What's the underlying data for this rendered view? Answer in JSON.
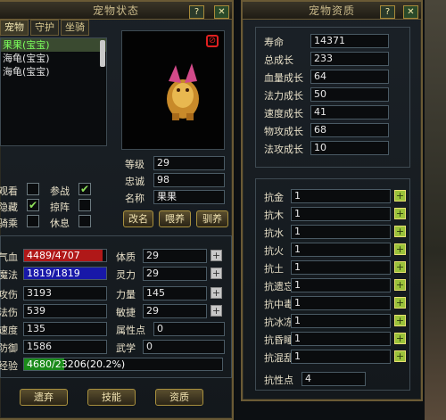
{
  "colors": {
    "hp_bar": "#b01818",
    "mp_bar": "#1818a8",
    "exp_bar": "#1a8a1a",
    "selected_text": "#7cff5c"
  },
  "left_panel": {
    "title": "宠物状态",
    "help_label": "?",
    "close_label": "✕",
    "tabs": [
      "宠物",
      "守护",
      "坐骑"
    ],
    "pets": [
      "果果(宝宝)",
      "海龟(宝宝)",
      "海龟(宝宝)"
    ],
    "options": {
      "watch": "观看",
      "fight": "参战",
      "hide": "隐藏",
      "dodge": "掠阵",
      "ride": "骑乘",
      "rest": "休息"
    },
    "info": {
      "level_label": "等级",
      "level": "29",
      "loyalty_label": "忠诚",
      "loyalty": "98",
      "name_label": "名称",
      "name": "果果"
    },
    "actions": {
      "rename": "改名",
      "feed": "喂养",
      "train": "驯养"
    },
    "stats": {
      "hp_label": "气血",
      "hp": "4489/4707",
      "mp_label": "魔法",
      "mp": "1819/1819",
      "atk_label": "攻伤",
      "atk": "3193",
      "def_label": "法伤",
      "def": "539",
      "spd_label": "速度",
      "spd": "135",
      "mdef_label": "防御",
      "mdef": "1586",
      "exp_label": "经验",
      "exp": "4680/23206(20.2%)",
      "exp_ratio": 0.202,
      "hp_ratio": 0.954,
      "con_label": "体质",
      "con": "29",
      "spi_label": "灵力",
      "spi": "29",
      "str_label": "力量",
      "str": "145",
      "agi_label": "敏捷",
      "agi": "29",
      "pts_label": "属性点",
      "pts": "0",
      "wuxue_label": "武学",
      "wuxue": "0"
    },
    "bottom_buttons": {
      "release": "遗弃",
      "skills": "技能",
      "aptitude": "资质"
    }
  },
  "right_panel": {
    "title": "宠物资质",
    "help_label": "?",
    "close_label": "✕",
    "growth": [
      {
        "label": "寿命",
        "value": "14371"
      },
      {
        "label": "总成长",
        "value": "233"
      },
      {
        "label": "血量成长",
        "value": "64"
      },
      {
        "label": "法力成长",
        "value": "50"
      },
      {
        "label": "速度成长",
        "value": "41"
      },
      {
        "label": "物攻成长",
        "value": "68"
      },
      {
        "label": "法攻成长",
        "value": "10"
      }
    ],
    "resist": [
      {
        "label": "抗金",
        "value": "1"
      },
      {
        "label": "抗木",
        "value": "1"
      },
      {
        "label": "抗水",
        "value": "1"
      },
      {
        "label": "抗火",
        "value": "1"
      },
      {
        "label": "抗土",
        "value": "1"
      },
      {
        "label": "抗遗忘",
        "value": "1"
      },
      {
        "label": "抗中毒",
        "value": "1"
      },
      {
        "label": "抗冰冻",
        "value": "1"
      },
      {
        "label": "抗昏睡",
        "value": "1"
      },
      {
        "label": "抗混乱",
        "value": "1"
      }
    ],
    "points_label": "抗性点",
    "points": "4"
  }
}
